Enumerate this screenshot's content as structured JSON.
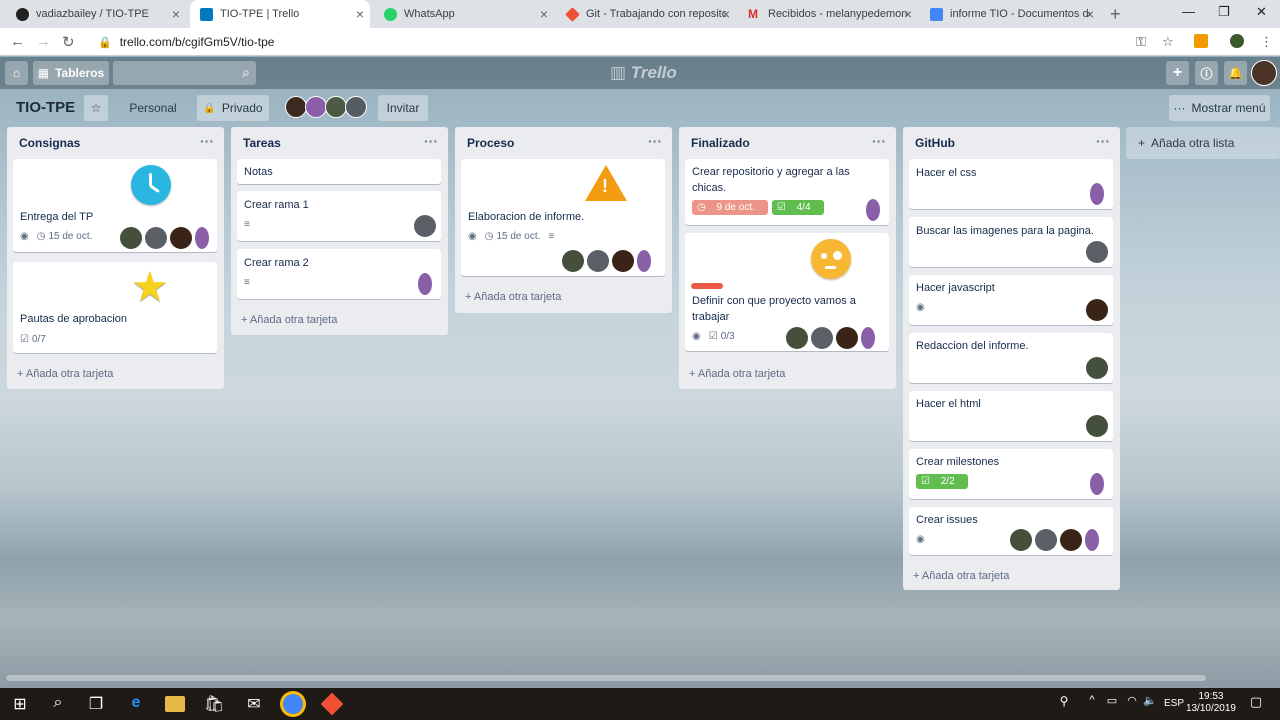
{
  "browser": {
    "tabs": [
      {
        "title": "vadiazbailey / TIO-TPE",
        "favicon": "github-icon",
        "color": "#222"
      },
      {
        "title": "TIO-TPE | Trello",
        "favicon": "trello-icon",
        "color": "#0079bf"
      },
      {
        "title": "WhatsApp",
        "favicon": "whatsapp-icon",
        "color": "#25d366"
      },
      {
        "title": "Git - Trabajando con repositori",
        "favicon": "git-icon",
        "color": "#f05033"
      },
      {
        "title": "Recibidos - melanypedemonte",
        "favicon": "gmail-icon",
        "color": "#d93025"
      },
      {
        "title": "informe TIO - Documentos de",
        "favicon": "docs-icon",
        "color": "#4285f4"
      }
    ],
    "url": "trello.com/b/cgifGm5V/tio-tpe"
  },
  "trello_header": {
    "boards_label": "Tableros",
    "logo": "Trello"
  },
  "board": {
    "title": "TIO-TPE",
    "team": "Personal",
    "visibility": "Privado",
    "invite": "Invitar",
    "menu": "Mostrar menú",
    "add_list": "Añada otra lista"
  },
  "lists": [
    {
      "name": "Consignas",
      "add": "Añada otra tarjeta",
      "cards": [
        {
          "title": "Entrega del TP",
          "sticker": "clock-icon",
          "date": "15 de oct."
        },
        {
          "title": "Pautas de aprobacion",
          "sticker": "star-icon",
          "checklist": "0/7"
        }
      ]
    },
    {
      "name": "Tareas",
      "add": "Añada otra tarjeta",
      "cards": [
        {
          "title": "Notas"
        },
        {
          "title": "Crear rama 1"
        },
        {
          "title": "Crear rama 2"
        }
      ]
    },
    {
      "name": "Proceso",
      "add": "Añada otra tarjeta",
      "cards": [
        {
          "title": "Elaboracion de informe.",
          "sticker": "warning-icon",
          "date": "15 de oct."
        }
      ]
    },
    {
      "name": "Finalizado",
      "add": "Añada otra tarjeta",
      "cards": [
        {
          "title": "Crear repositorio y agregar a las chicas.",
          "date": "9 de oct.",
          "checklist": "4/4"
        },
        {
          "title": "Definir con que proyecto vamos a trabajar",
          "sticker": "face-icon",
          "checklist": "0/3"
        }
      ]
    },
    {
      "name": "GitHub",
      "add": "Añada otra tarjeta",
      "cards": [
        {
          "title": "Hacer el css"
        },
        {
          "title": "Buscar las imagenes para la pagina."
        },
        {
          "title": "Hacer javascript"
        },
        {
          "title": "Redaccion del informe."
        },
        {
          "title": "Hacer el html"
        },
        {
          "title": "Crear milestones",
          "checklist": "2/2"
        },
        {
          "title": "Crear issues"
        }
      ]
    }
  ],
  "colors": {
    "overdue": "#ec9488",
    "complete": "#61bd4f",
    "label_red": "#eb5a46"
  },
  "taskbar": {
    "lang": "ESP",
    "time": "19:53",
    "date": "13/10/2019"
  }
}
